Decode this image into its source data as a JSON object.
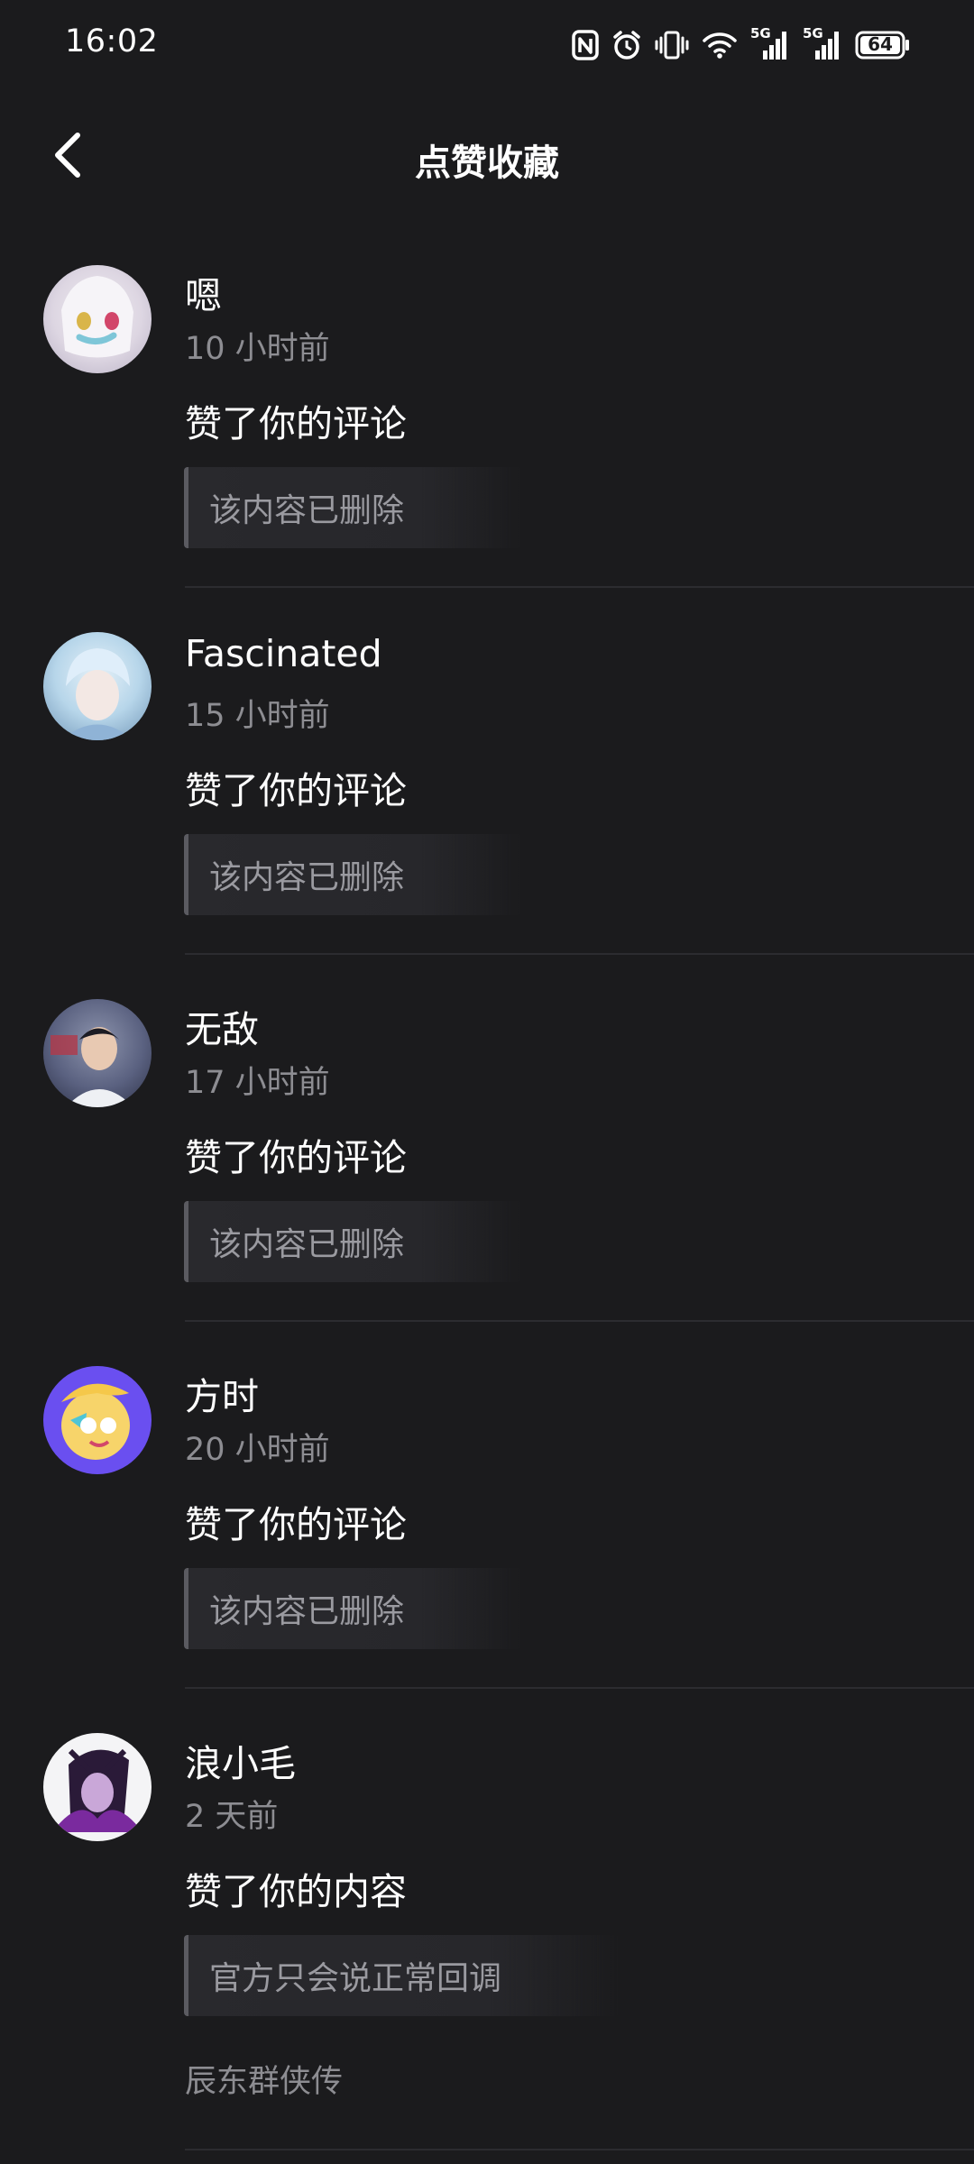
{
  "status_bar": {
    "time": "16:02",
    "icons": [
      "nfc-icon",
      "alarm-icon",
      "vibrate-icon",
      "wifi-icon",
      "signal-5g-icon",
      "signal-5g-icon",
      "battery-icon"
    ],
    "network_label_1": "5G",
    "network_label_2": "5G",
    "battery_level": "64"
  },
  "header": {
    "title": "点赞收藏",
    "back_icon": "chevron-left-icon"
  },
  "notifications": [
    {
      "username": "嗯",
      "time": "10 小时前",
      "action": "赞了你的评论",
      "quote": "该内容已删除",
      "avatar_colors": [
        "#e9e4ea",
        "#b8b0c4"
      ]
    },
    {
      "username": "Fascinated",
      "time": "15 小时前",
      "action": "赞了你的评论",
      "quote": "该内容已删除",
      "avatar_colors": [
        "#b7d6ea",
        "#6e93b5"
      ]
    },
    {
      "username": "无敌",
      "time": "17 小时前",
      "action": "赞了你的评论",
      "quote": "该内容已删除",
      "avatar_colors": [
        "#6b7390",
        "#2c3046"
      ]
    },
    {
      "username": "方时",
      "time": "20 小时前",
      "action": "赞了你的评论",
      "quote": "该内容已删除",
      "avatar_colors": [
        "#7b5cf0",
        "#f5c84a"
      ]
    },
    {
      "username": "浪小毛",
      "time": "2 天前",
      "action": "赞了你的内容",
      "quote": "官方只会说正常回调",
      "source": "辰东群侠传",
      "avatar_colors": [
        "#f4f4f6",
        "#4a2a5e"
      ]
    }
  ],
  "colors": {
    "background": "#1b1b1d",
    "secondary_text": "#8d8d92",
    "quote_background": "#29292d",
    "quote_border": "#5b5b61",
    "divider": "#2c2c30"
  }
}
